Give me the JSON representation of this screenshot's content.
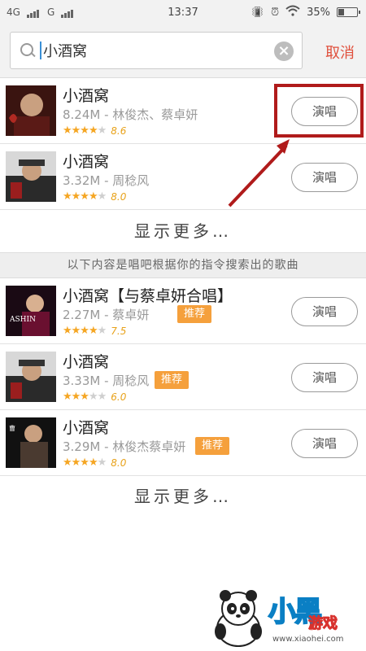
{
  "status_bar": {
    "network1": "4G",
    "network2": "G",
    "time": "13:37",
    "battery": "35%"
  },
  "search": {
    "value": "小酒窝",
    "cancel_label": "取消"
  },
  "results": [
    {
      "title": "小酒窝",
      "meta": "8.24M - 林俊杰、蔡卓妍",
      "stars": 4.5,
      "score": "8.6",
      "badge": "",
      "button_label": "演唱",
      "cover_colors": [
        "#3a1410",
        "#b02a22"
      ]
    },
    {
      "title": "小酒窝",
      "meta": "3.32M - 周稔风",
      "stars": 4,
      "score": "8.0",
      "badge": "",
      "button_label": "演唱",
      "cover_colors": [
        "#2a2a2a",
        "#9a1e1e"
      ]
    }
  ],
  "show_more_label": "显示更多…",
  "section_header": "以下内容是唱吧根据你的指令搜索出的歌曲",
  "recommended": [
    {
      "title": "小酒窝【与蔡卓妍合唱】",
      "meta": "2.27M - 蔡卓妍",
      "stars": 4,
      "score": "7.5",
      "badge": "推荐",
      "button_label": "演唱",
      "cover_colors": [
        "#1a0a14",
        "#6a1030"
      ]
    },
    {
      "title": "小酒窝",
      "meta": "3.33M - 周稔风",
      "stars": 3,
      "score": "6.0",
      "badge": "推荐",
      "button_label": "演唱",
      "cover_colors": [
        "#2a2a2a",
        "#9a1e1e"
      ]
    },
    {
      "title": "小酒窝",
      "meta": "3.29M - 林俊杰蔡卓妍",
      "stars": 4,
      "score": "8.0",
      "badge": "推荐",
      "button_label": "演唱",
      "cover_colors": [
        "#111111",
        "#4a3a30"
      ]
    }
  ],
  "show_more_label_2": "显示更多…",
  "watermark": {
    "logo_text": "小黑",
    "logo_sub": "游戏",
    "url": "www.xiaohei.com"
  },
  "colors": {
    "accent": "#e0503c",
    "highlight": "#b01b1b",
    "badge": "#f5a03c",
    "star": "#f5a623"
  }
}
